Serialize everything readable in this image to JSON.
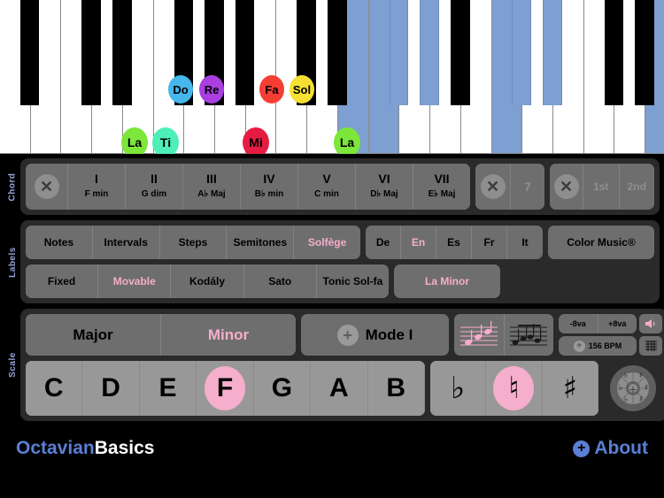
{
  "piano": {
    "highlight_color": "#7d9fd1",
    "notes": [
      {
        "label": "La",
        "color": "#7ce63a",
        "key": "white",
        "index": 11,
        "type": "white"
      },
      {
        "label": "Ti",
        "color": "#4deeb8",
        "key": "white",
        "index": 12,
        "type": "white"
      },
      {
        "label": "Do",
        "color": "#45b7ed",
        "key": "black",
        "index": 13,
        "type": "black"
      },
      {
        "label": "Re",
        "color": "#a93fe0",
        "key": "black",
        "index": 14,
        "type": "black"
      },
      {
        "label": "Mi",
        "color": "#e61b42",
        "key": "white",
        "index": 16,
        "type": "white"
      },
      {
        "label": "Fa",
        "color": "#f53d34",
        "key": "black",
        "index": 17,
        "type": "black"
      },
      {
        "label": "Sol",
        "color": "#f5e033",
        "key": "black",
        "index": 18,
        "type": "black"
      },
      {
        "label": "La",
        "color": "#7ce63a",
        "key": "white",
        "index": 21,
        "type": "white"
      }
    ]
  },
  "sections": {
    "chord_label": "Chord",
    "labels_label": "Labels",
    "scale_label": "Scale"
  },
  "chord": {
    "clear_icon": "close-x-icon",
    "degrees": [
      {
        "roman": "I",
        "name": "F min"
      },
      {
        "roman": "II",
        "name": "G dim"
      },
      {
        "roman": "III",
        "name": "A♭ Maj"
      },
      {
        "roman": "IV",
        "name": "B♭ min"
      },
      {
        "roman": "V",
        "name": "C min"
      },
      {
        "roman": "VI",
        "name": "D♭ Maj"
      },
      {
        "roman": "VII",
        "name": "E♭ Maj"
      }
    ],
    "seventh_label": "7",
    "inversions": [
      "1st",
      "2nd"
    ]
  },
  "labels": {
    "naming": [
      {
        "label": "Notes",
        "active": false
      },
      {
        "label": "Intervals",
        "active": false
      },
      {
        "label": "Steps",
        "active": false
      },
      {
        "label": "Semitones",
        "active": false
      },
      {
        "label": "Solfège",
        "active": true
      }
    ],
    "languages": [
      {
        "label": "De",
        "active": false
      },
      {
        "label": "En",
        "active": true
      },
      {
        "label": "Es",
        "active": false
      },
      {
        "label": "Fr",
        "active": false
      },
      {
        "label": "It",
        "active": false
      }
    ],
    "color_music": "Color Music®",
    "systems": [
      {
        "label": "Fixed",
        "active": false
      },
      {
        "label": "Movable",
        "active": true
      },
      {
        "label": "Kodály",
        "active": false
      },
      {
        "label": "Sato",
        "active": false
      },
      {
        "label": "Tonic Sol-fa",
        "active": false
      }
    ],
    "minor_mode": {
      "label": "La Minor",
      "active": true
    }
  },
  "scale": {
    "tonality": [
      {
        "label": "Major",
        "active": false
      },
      {
        "label": "Minor",
        "active": true
      }
    ],
    "mode": {
      "label": "Mode I",
      "icon": "plus-circle-icon"
    },
    "notation_icons": [
      {
        "name": "staff-ascending-icon",
        "active": true
      },
      {
        "name": "staff-notes-icon",
        "active": false
      }
    ],
    "octave": [
      {
        "label": "-8va"
      },
      {
        "label": "+8va"
      }
    ],
    "tempo": {
      "label": "156 BPM",
      "icon": "plus-circle-icon"
    },
    "speaker_icon": "speaker-icon",
    "settings_icon": "sliders-icon",
    "letters": [
      {
        "label": "C",
        "active": false
      },
      {
        "label": "D",
        "active": false
      },
      {
        "label": "E",
        "active": false
      },
      {
        "label": "F",
        "active": true
      },
      {
        "label": "G",
        "active": false
      },
      {
        "label": "A",
        "active": false
      },
      {
        "label": "B",
        "active": false
      }
    ],
    "accidentals": [
      {
        "label": "♭",
        "name": "flat-icon",
        "active": false
      },
      {
        "label": "♮",
        "name": "natural-icon",
        "active": true
      },
      {
        "label": "♯",
        "name": "sharp-icon",
        "active": false
      }
    ],
    "key_wheel_icon": "key-signature-wheel-icon"
  },
  "footer": {
    "brand_first": "Octavian",
    "brand_second": "Basics",
    "about_label": "About",
    "about_icon": "plus-circle-icon",
    "accent_color": "#5a7fd4"
  }
}
